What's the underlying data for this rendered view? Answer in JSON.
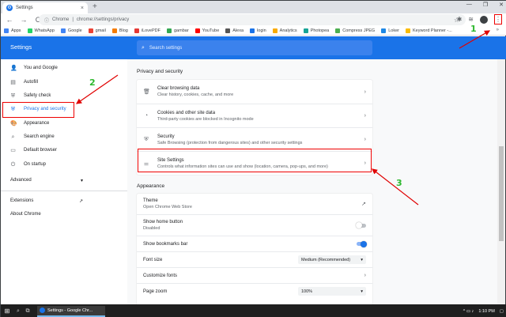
{
  "browser": {
    "tab_title": "Settings",
    "tab_close": "×",
    "new_tab": "+",
    "window_controls": [
      "—",
      "❐",
      "✕"
    ],
    "back": "←",
    "forward": "→",
    "reload": "C",
    "url_chip": "Chrome",
    "url": "chrome://settings/privacy",
    "star": "☆",
    "menu_glyph": "⋮"
  },
  "bookmarks": {
    "items": [
      {
        "label": "Apps",
        "color": "#4285f4"
      },
      {
        "label": "WhatsApp",
        "color": "#25d366"
      },
      {
        "label": "Google",
        "color": "#4285f4"
      },
      {
        "label": "gmail",
        "color": "#ea4335"
      },
      {
        "label": "Blog",
        "color": "#f57c00"
      },
      {
        "label": "iLovePDF",
        "color": "#e53935"
      },
      {
        "label": "gambar",
        "color": "#34a853"
      },
      {
        "label": "YouTube",
        "color": "#ff0000"
      },
      {
        "label": "Alexa",
        "color": "#555"
      },
      {
        "label": "login",
        "color": "#1a73e8"
      },
      {
        "label": "Analytics",
        "color": "#f9ab00"
      },
      {
        "label": "Photopea",
        "color": "#18a497"
      },
      {
        "label": "Compress JPEG",
        "color": "#4caf50"
      },
      {
        "label": "Loker",
        "color": "#1e88e5"
      },
      {
        "label": "Keyword Planner -...",
        "color": "#fbbc04"
      }
    ],
    "more": "»"
  },
  "settings": {
    "title": "Settings",
    "search_placeholder": "Search settings"
  },
  "sidebar": {
    "items": [
      {
        "label": "You and Google",
        "icon": "👤"
      },
      {
        "label": "Autofill",
        "icon": "▤"
      },
      {
        "label": "Safety check",
        "icon": "⛨"
      },
      {
        "label": "Privacy and security",
        "icon": "⛨"
      },
      {
        "label": "Appearance",
        "icon": "🎨"
      },
      {
        "label": "Search engine",
        "icon": "⌕"
      },
      {
        "label": "Default browser",
        "icon": "▭"
      },
      {
        "label": "On startup",
        "icon": "⏻"
      }
    ],
    "advanced": "Advanced",
    "advanced_chevron": "▾",
    "extensions": "Extensions",
    "extensions_icon": "↗",
    "about": "About Chrome"
  },
  "privacy": {
    "section_title": "Privacy and security",
    "rows": [
      {
        "title": "Clear browsing data",
        "desc": "Clear history, cookies, cache, and more",
        "icon": "🗑"
      },
      {
        "title": "Cookies and other site data",
        "desc": "Third-party cookies are blocked in Incognito mode",
        "icon": "◔"
      },
      {
        "title": "Security",
        "desc": "Safe Browsing (protection from dangerous sites) and other security settings",
        "icon": "⛨"
      },
      {
        "title": "Site Settings",
        "desc": "Controls what information sites can use and show (location, camera, pop-ups, and more)",
        "icon": "⚌"
      }
    ],
    "arrow": "›"
  },
  "appearance": {
    "section_title": "Appearance",
    "theme_title": "Theme",
    "theme_desc": "Open Chrome Web Store",
    "theme_icon": "↗",
    "home_title": "Show home button",
    "home_desc": "Disabled",
    "home_on": false,
    "bookmarks_bar": "Show bookmarks bar",
    "bookmarks_on": true,
    "font_size_label": "Font size",
    "font_size_value": "Medium (Recommended)",
    "customize_fonts": "Customize fonts",
    "page_zoom_label": "Page zoom",
    "page_zoom_value": "100%",
    "select_chevron": "▾"
  },
  "annotations": {
    "n1": "1",
    "n2": "2",
    "n3": "3",
    "color": "#e00000",
    "num_color": "#2eb82e"
  },
  "taskbar": {
    "start": "⊞",
    "search": "⌕",
    "taskview": "⧉",
    "app_label": "Settings - Google Chr...",
    "tray_icons": "^ ▭ ♪",
    "time": "1:10 PM",
    "notification": "▢"
  }
}
